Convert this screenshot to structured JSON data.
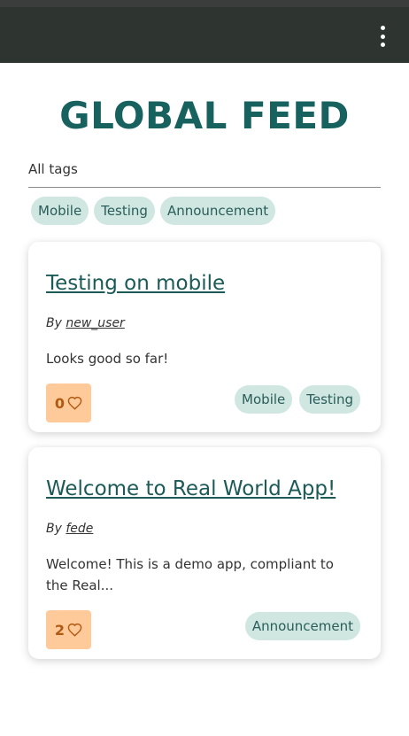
{
  "app_bar": {
    "menu_icon": "more-vert-icon"
  },
  "page": {
    "title": "GLOBAL FEED"
  },
  "filter": {
    "select_label": "All tags",
    "tags": [
      "Mobile",
      "Testing",
      "Announcement"
    ]
  },
  "articles": [
    {
      "title": "Testing on mobile",
      "by_label": "By",
      "author": "new_user",
      "body": "Looks good so far!",
      "likes": "0",
      "tags": [
        "Mobile",
        "Testing"
      ]
    },
    {
      "title": "Welcome to Real World App!",
      "by_label": "By",
      "author": "fede",
      "body": "Welcome! This is a demo app, compliant to the Real...",
      "likes": "2",
      "tags": [
        "Announcement"
      ]
    }
  ],
  "colors": {
    "app_bar": "#2e3531",
    "title": "#17615f",
    "chip_bg": "#cfe6e1",
    "like_bg": "#ffca99",
    "like_text": "#b05a12"
  }
}
